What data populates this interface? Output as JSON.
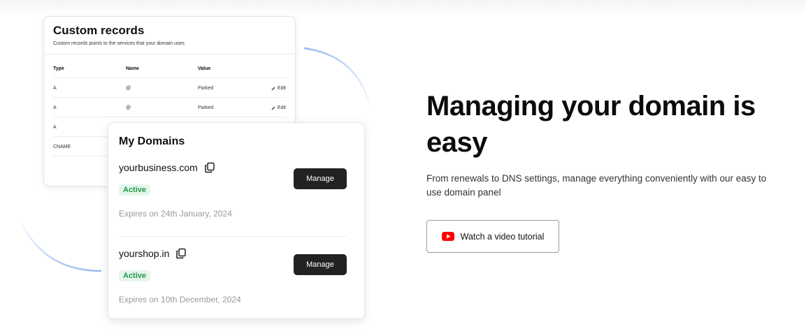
{
  "records_card": {
    "title": "Custom records",
    "subtitle": "Custom records points to the services that your domain uses",
    "columns": [
      "Type",
      "Name",
      "Value"
    ],
    "rows": [
      {
        "type": "A",
        "name": "@",
        "value": "Parked",
        "edit": "Edit"
      },
      {
        "type": "A",
        "name": "@",
        "value": "Parked",
        "edit": "Edit"
      },
      {
        "type": "A",
        "name": "",
        "value": "",
        "edit": ""
      },
      {
        "type": "CNAME",
        "name": "",
        "value": "",
        "edit": ""
      }
    ]
  },
  "domains_card": {
    "title": "My Domains",
    "domains": [
      {
        "name": "yourbusiness.com",
        "status": "Active",
        "expires": "Expires on 24th January, 2024",
        "manage_label": "Manage"
      },
      {
        "name": "yourshop.in",
        "status": "Active",
        "expires": "Expires on 10th December, 2024",
        "manage_label": "Manage"
      }
    ]
  },
  "hero": {
    "headline": "Managing your domain is easy",
    "description": "From renewals to DNS settings, manage everything conveniently with our easy to use domain panel",
    "video_button_label": "Watch a video tutorial"
  },
  "icons": {
    "copy": "copy-icon",
    "edit": "pencil-icon",
    "video": "youtube-icon"
  },
  "colors": {
    "accent_arc": "#8fb0ef",
    "button_dark": "#222222",
    "active_bg": "#e7f6ec",
    "active_text": "#1e9a4b",
    "youtube_red": "#ff0000"
  }
}
